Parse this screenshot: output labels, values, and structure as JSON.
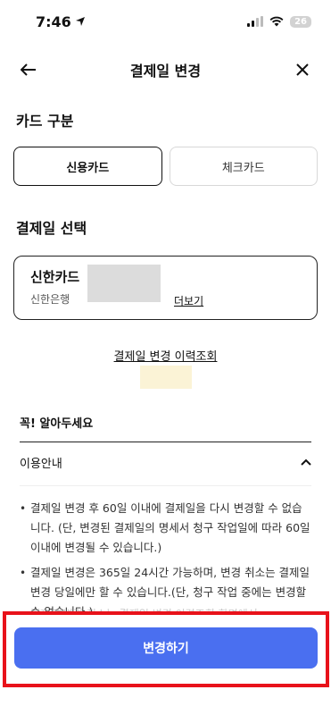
{
  "status_bar": {
    "time": "7:46",
    "battery": "26"
  },
  "nav": {
    "title": "결제일 변경"
  },
  "card_type": {
    "title": "카드 구분",
    "options": [
      "신용카드",
      "체크카드"
    ],
    "selected": "신용카드"
  },
  "payment_day": {
    "title": "결제일 선택",
    "card_name": "신한카드",
    "bank": "신한은행",
    "more_label": "더보기"
  },
  "history_link": "결제일 변경 이력조회",
  "notice": {
    "title": "꼭! 알아두세요",
    "section_label": "이용안내",
    "bullets": [
      "결제일 변경 후 60일 이내에 결제일을 다시 변경할 수 없습니다. (단, 변경된 결제일의 명세서 청구 작업일에 따라 60일 이내에 변경될 수 있습니다.)",
      "결제일 변경은 365일 24시간 가능하며, 변경 취소는 결제일 변경 당일에만 할 수 있습니다.(단, 청구 작업 중에는 변경할 수 없습니다.)"
    ],
    "cut_off_text": "결제일 변경 취소는 결제일 변경 이력조회 화면에서"
  },
  "primary_button": {
    "label": "변경하기"
  },
  "colors": {
    "primary": "#4a6ff0",
    "highlight": "#e8121a"
  }
}
